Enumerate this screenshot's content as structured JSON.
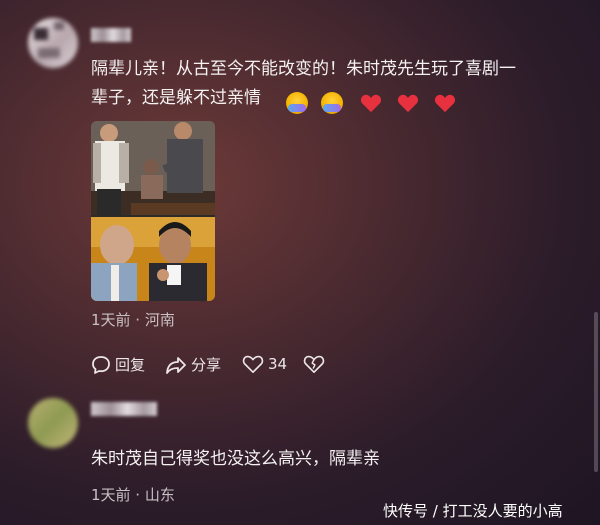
{
  "comment1": {
    "text_line1": "隔辈儿亲！从古至今不能改变的！朱时茂先生玩了喜剧一",
    "text_line2": "辈子，还是躲不过亲情",
    "emojis": [
      "hug-emoji",
      "hug-emoji",
      "red-heart",
      "red-heart",
      "red-heart"
    ],
    "meta": "1天前 · 河南",
    "reply_label": "回复",
    "share_label": "分享",
    "like_count": "34"
  },
  "comment2": {
    "text": "朱时茂自己得奖也没这么高兴，隔辈亲",
    "meta": "1天前 · 山东"
  },
  "watermark": "快传号 / 打工没人要的小高",
  "colors": {
    "heart": "#e8313f",
    "text": "#f5f1f1",
    "meta": "#c9c0c3"
  }
}
